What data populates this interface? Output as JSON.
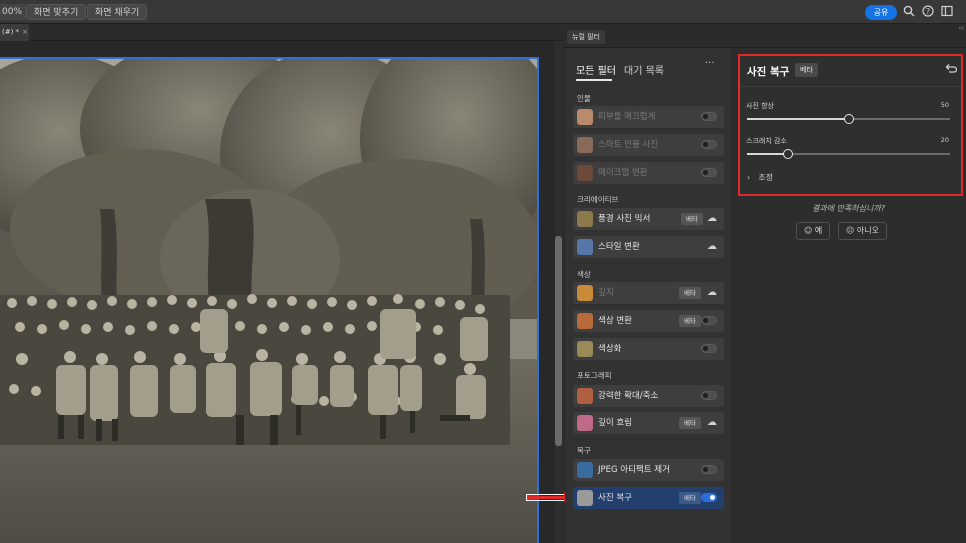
{
  "toolbar": {
    "zoom": "00%",
    "fit_screen": "화면 맞추기",
    "fill_screen": "화면 채우기",
    "share": "공유"
  },
  "document": {
    "tab_label": "(#) *",
    "close": "×"
  },
  "panel": {
    "tab": "뉴럴 필터"
  },
  "filter_list": {
    "tabs": [
      "모든 필터",
      "대기 목록"
    ],
    "more": "···",
    "categories": [
      {
        "name": "인물",
        "filters": [
          {
            "label": "피부를 매끄럽게",
            "control": "toggle",
            "on": false,
            "dim": true,
            "thumb": "#b98a6c"
          },
          {
            "label": "스마트 인물 사진",
            "control": "toggle",
            "on": false,
            "dim": true,
            "thumb": "#8a6b5a"
          },
          {
            "label": "메이크업 변환",
            "control": "toggle",
            "on": false,
            "dim": true,
            "thumb": "#6b4a3a"
          }
        ]
      },
      {
        "name": "크리에이티브",
        "filters": [
          {
            "label": "풍경 사진 믹서",
            "badge": "베타",
            "control": "cloud",
            "dim": false,
            "thumb": "#8c7a4c"
          },
          {
            "label": "스타일 변환",
            "control": "cloud",
            "dim": false,
            "thumb": "#5577aa"
          }
        ]
      },
      {
        "name": "색상",
        "filters": [
          {
            "label": "깊지",
            "badge": "베타",
            "control": "cloud",
            "dim": true,
            "thumb": "#c98a3a"
          },
          {
            "label": "색상 변환",
            "badge": "베타",
            "control": "toggle",
            "on": false,
            "dim": false,
            "thumb": "#b86a3a"
          },
          {
            "label": "색상화",
            "control": "toggle",
            "on": false,
            "dim": false,
            "thumb": "#9a8a5a"
          }
        ]
      },
      {
        "name": "포토그래피",
        "filters": [
          {
            "label": "강력한 확대/축소",
            "control": "toggle",
            "on": false,
            "dim": false,
            "thumb": "#b06040"
          },
          {
            "label": "깊이 흐림",
            "badge": "베타",
            "control": "cloud",
            "dim": false,
            "thumb": "#c06a8a"
          }
        ]
      },
      {
        "name": "복구",
        "filters": [
          {
            "label": "JPEG 아티팩트 제거",
            "control": "toggle",
            "on": false,
            "dim": false,
            "thumb": "#3a6aa0"
          },
          {
            "label": "사진 복구",
            "badge": "베타",
            "control": "toggle",
            "on": true,
            "dim": false,
            "selected": true,
            "thumb": "#9a9a9a"
          }
        ]
      }
    ]
  },
  "params": {
    "title": "사진 복구",
    "beta": "베타",
    "sliders": [
      {
        "label": "사진 향상",
        "value": 50,
        "max": 100
      },
      {
        "label": "스크래치 감소",
        "value": 20,
        "max": 100
      }
    ],
    "adjust": "조정"
  },
  "feedback": {
    "question": "결과에 만족하십니까?",
    "yes": "예",
    "no": "아니오"
  },
  "colors": {
    "accent": "#1473e6",
    "highlight": "#e02a2a",
    "selected_row": "#223f6d"
  }
}
